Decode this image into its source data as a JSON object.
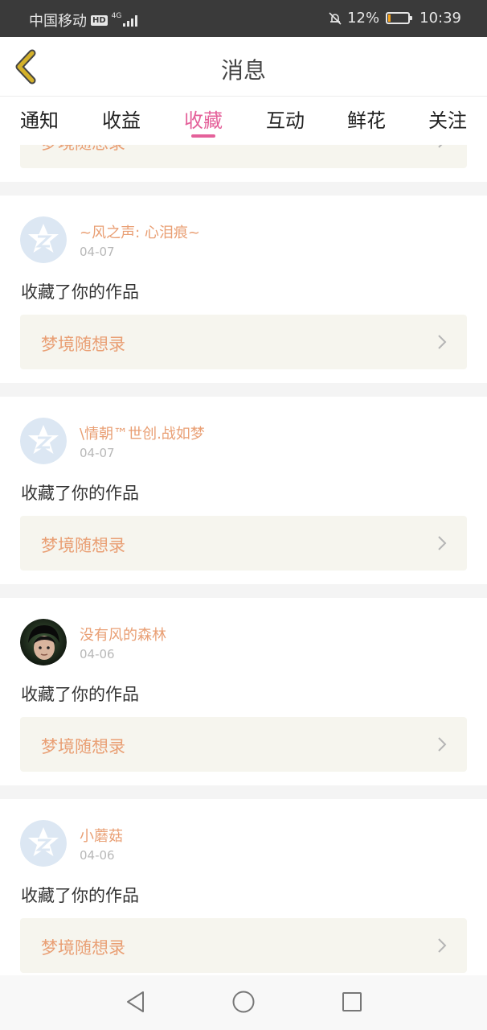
{
  "status_bar": {
    "carrier": "中国移动",
    "hd": "HD",
    "network": "4G",
    "battery_text": "12%",
    "battery_level": 0.12,
    "time": "10:39",
    "mute_icon": "bell-off-icon"
  },
  "header": {
    "back_icon": "chevron-left-icon",
    "title": "消息"
  },
  "tabs": [
    {
      "label": "通知",
      "active": false
    },
    {
      "label": "收益",
      "active": false
    },
    {
      "label": "收藏",
      "active": true
    },
    {
      "label": "互动",
      "active": false
    },
    {
      "label": "鲜花",
      "active": false
    },
    {
      "label": "关注",
      "active": false
    }
  ],
  "partial_top_work": "梦境随想录",
  "items": [
    {
      "user": "~风之声: 心泪痕~",
      "date": "04-07",
      "action": "收藏了你的作品",
      "work": "梦境随想录",
      "avatar": "default-avatar-icon"
    },
    {
      "user": "\\情朝™世创.战如梦",
      "date": "04-07",
      "action": "收藏了你的作品",
      "work": "梦境随想录",
      "avatar": "default-avatar-icon"
    },
    {
      "user": "没有风的森林",
      "date": "04-06",
      "action": "收藏了你的作品",
      "work": "梦境随想录",
      "avatar": "user-photo-avatar"
    },
    {
      "user": "小蘑菇",
      "date": "04-06",
      "action": "收藏了你的作品",
      "work": "梦境随想录",
      "avatar": "default-avatar-icon"
    }
  ],
  "colors": {
    "accent": "#e4619a",
    "name_color": "#e99f74",
    "work_bg": "#f6f5ee",
    "back_arrow": "#d4b12a",
    "status_bar_bg": "#3a3a3a"
  },
  "nav": [
    "back-triangle-icon",
    "home-circle-icon",
    "recents-square-icon"
  ]
}
